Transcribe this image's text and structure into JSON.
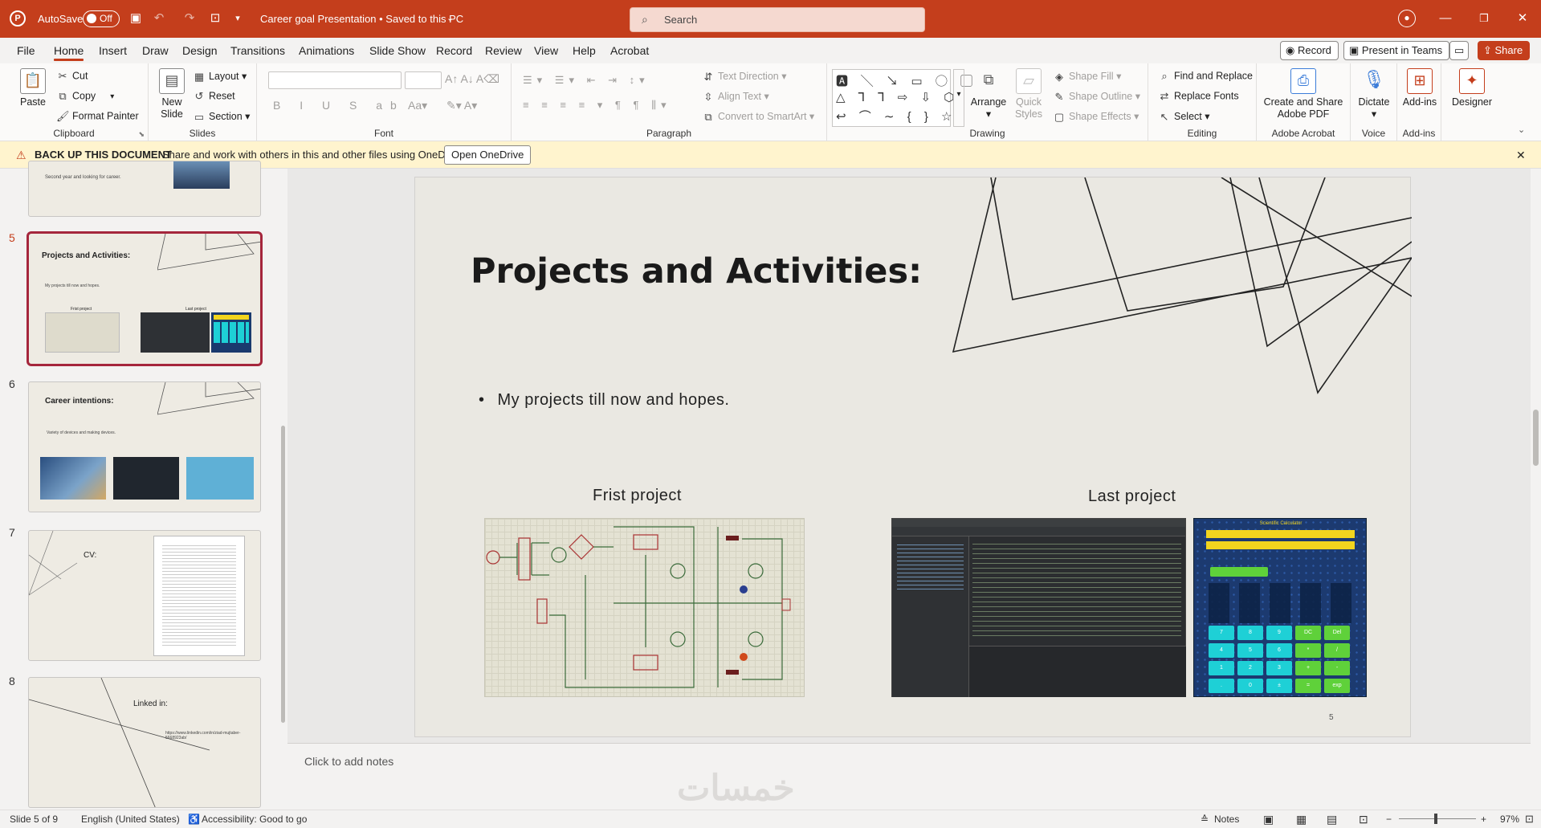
{
  "titlebar": {
    "autosave_label": "AutoSave",
    "autosave_state": "Off",
    "doc_title": "Career goal Presentation • Saved to this PC",
    "search_placeholder": "Search"
  },
  "menu": {
    "tabs": [
      "File",
      "Home",
      "Insert",
      "Draw",
      "Design",
      "Transitions",
      "Animations",
      "Slide Show",
      "Record",
      "Review",
      "View",
      "Help",
      "Acrobat"
    ],
    "active": "Home",
    "record_btn": "Record",
    "present_btn": "Present in Teams",
    "share_btn": "Share"
  },
  "ribbon": {
    "clipboard": {
      "label": "Clipboard",
      "paste": "Paste",
      "cut": "Cut",
      "copy": "Copy",
      "format_painter": "Format Painter"
    },
    "slides": {
      "label": "Slides",
      "new_slide": "New",
      "new_slide2": "Slide",
      "layout": "Layout",
      "reset": "Reset",
      "section": "Section"
    },
    "font": {
      "label": "Font"
    },
    "paragraph": {
      "label": "Paragraph",
      "text_direction": "Text Direction",
      "align_text": "Align Text",
      "convert_smartart": "Convert to SmartArt"
    },
    "drawing": {
      "label": "Drawing",
      "arrange": "Arrange",
      "quick_styles": "Quick",
      "quick_styles2": "Styles",
      "shape_fill": "Shape Fill",
      "shape_outline": "Shape Outline",
      "shape_effects": "Shape Effects"
    },
    "editing": {
      "label": "Editing",
      "find_replace": "Find and Replace",
      "replace_fonts": "Replace Fonts",
      "select": "Select"
    },
    "acrobat": {
      "label": "Adobe Acrobat",
      "create_share": "Create and Share",
      "create_share2": "Adobe PDF"
    },
    "voice": {
      "label": "Voice",
      "dictate": "Dictate"
    },
    "addins": {
      "label": "Add-ins",
      "addins_btn": "Add-ins"
    },
    "designer": {
      "label": "Designer"
    }
  },
  "notification": {
    "title": "BACK UP THIS DOCUMENT",
    "message": "Share and work with others in this and other files using OneDrive.",
    "button": "Open OneDrive"
  },
  "thumbnails": {
    "partial_text": "Second year and looking for career.",
    "items": [
      {
        "num": "5",
        "title": "Projects and Activities:",
        "bullet": "My projects till now and hopes.",
        "cap1": "Frist project",
        "cap2": "Last project"
      },
      {
        "num": "6",
        "title": "Career intentions:",
        "bullet": "Variety of devices and making devices."
      },
      {
        "num": "7",
        "title": "CV:"
      },
      {
        "num": "8",
        "title": "Linked in:",
        "link": "https://www.linkedin.com/in/ziad-mujtaber-5668923ab/"
      }
    ]
  },
  "slide": {
    "title": "Projects and Activities:",
    "bullet": "My projects till now and hopes.",
    "caption_first": "Frist project",
    "caption_last": "Last project",
    "page_number": "5",
    "calc_title": "Scientific Calculator",
    "calc_keys": [
      "7",
      "8",
      "9",
      "DC",
      "Del",
      "4",
      "5",
      "6",
      "*",
      "/",
      "1",
      "2",
      "3",
      "+",
      "-",
      ".",
      "0",
      "±",
      "=",
      "exp"
    ]
  },
  "notes_placeholder": "Click to add notes",
  "status": {
    "slide_info": "Slide 5 of 9",
    "language": "English (United States)",
    "accessibility": "Accessibility: Good to go",
    "notes": "Notes",
    "zoom": "97%"
  },
  "colors": {
    "accent": "#c43e1c",
    "selected_border": "#a5263c",
    "notif_bg": "#fff4ce"
  }
}
